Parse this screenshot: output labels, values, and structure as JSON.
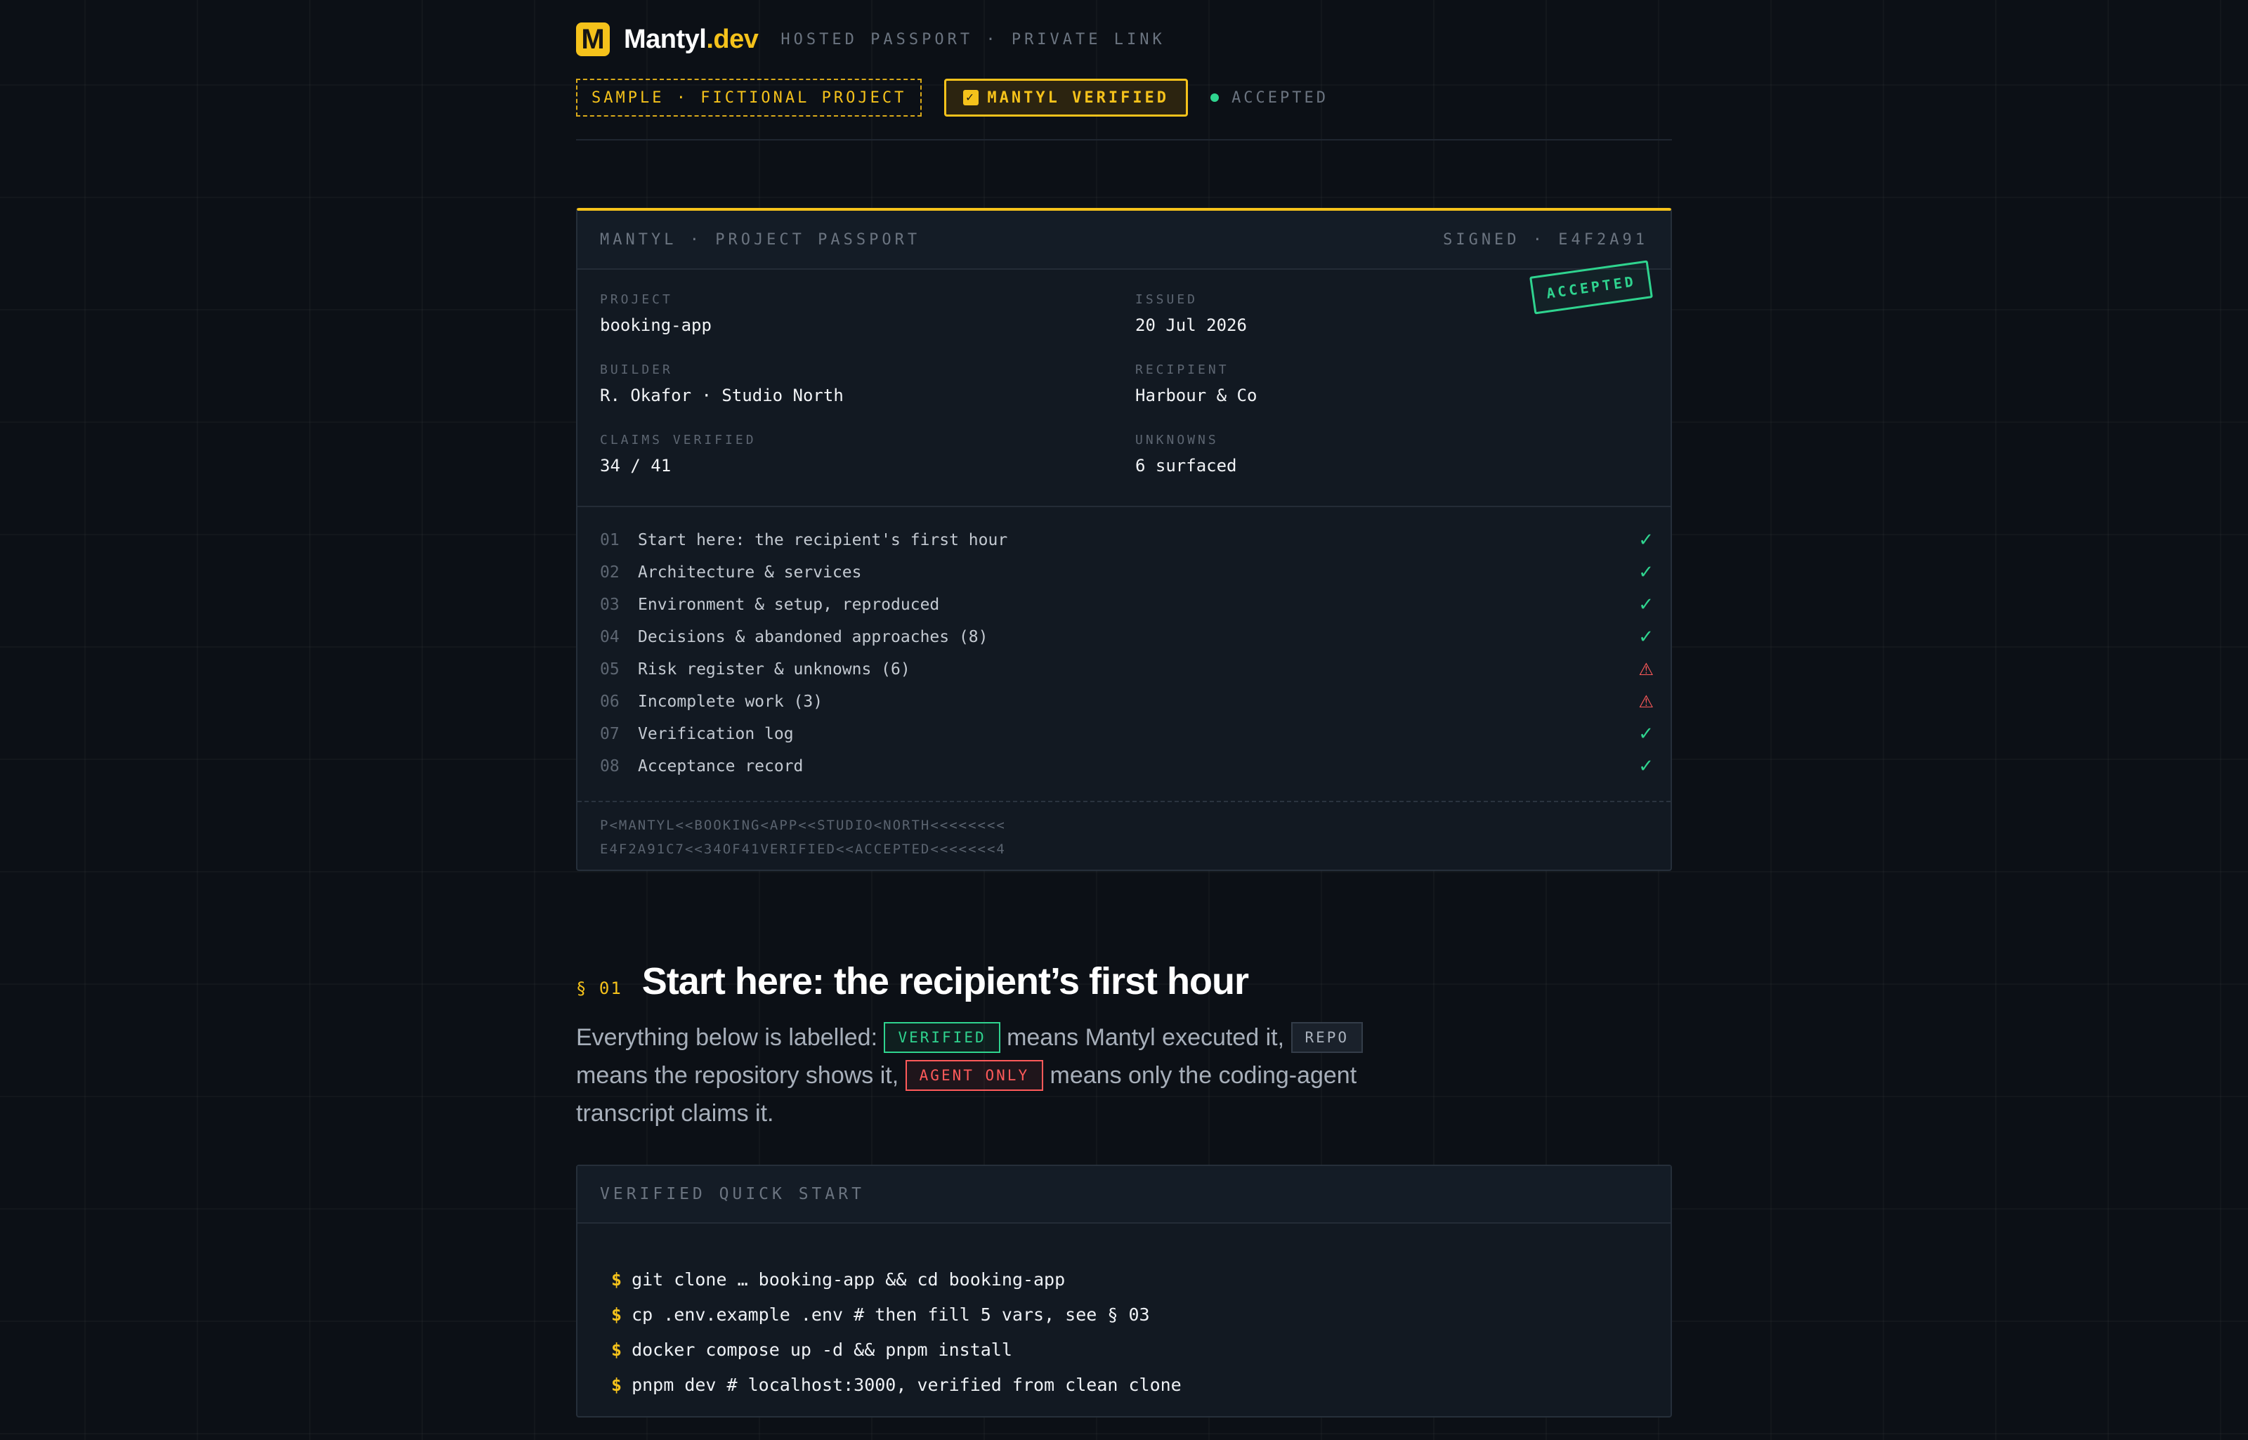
{
  "header": {
    "logo_letter": "M",
    "brand_name": "Mantyl",
    "brand_tld": ".dev",
    "tagline": "HOSTED PASSPORT · PRIVATE LINK"
  },
  "badges": {
    "sample": "SAMPLE · FICTIONAL PROJECT",
    "verified": "MANTYL VERIFIED",
    "status": "ACCEPTED"
  },
  "passport": {
    "title": "MANTYL · PROJECT PASSPORT",
    "signature": "SIGNED · E4F2A91",
    "stamp": "ACCEPTED",
    "fields": {
      "project_label": "PROJECT",
      "project_value": "booking-app",
      "issued_label": "ISSUED",
      "issued_value": "20 Jul 2026",
      "builder_label": "BUILDER",
      "builder_value": "R. Okafor · Studio North",
      "recipient_label": "RECIPIENT",
      "recipient_value": "Harbour & Co",
      "claims_label": "CLAIMS VERIFIED",
      "claims_value": "34 / 41",
      "unknowns_label": "UNKNOWNS",
      "unknowns_value": "6 surfaced"
    },
    "toc": [
      {
        "num": "01",
        "title": "Start here: the recipient's first hour",
        "status": "check-icon"
      },
      {
        "num": "02",
        "title": "Architecture & services",
        "status": "check-icon"
      },
      {
        "num": "03",
        "title": "Environment & setup, reproduced",
        "status": "check-icon"
      },
      {
        "num": "04",
        "title": "Decisions & abandoned approaches (8)",
        "status": "check-icon"
      },
      {
        "num": "05",
        "title": "Risk register & unknowns (6)",
        "status": "warning-icon"
      },
      {
        "num": "06",
        "title": "Incomplete work (3)",
        "status": "warning-icon"
      },
      {
        "num": "07",
        "title": "Verification log",
        "status": "check-icon"
      },
      {
        "num": "08",
        "title": "Acceptance record",
        "status": "check-icon"
      }
    ],
    "mrz_line1": "P<MANTYL<<BOOKING<APP<<STUDIO<NORTH<<<<<<<<",
    "mrz_line2": "E4F2A91C7<<34OF41VERIFIED<<ACCEPTED<<<<<<<4"
  },
  "section": {
    "number": "§ 01",
    "title": "Start here: the recipient’s first hour",
    "intro_1": "Everything below is labelled: ",
    "tag_verified": "VERIFIED",
    "intro_2": " means Mantyl executed it, ",
    "tag_repo": "REPO",
    "intro_3": " means the repository shows it, ",
    "tag_agent": "AGENT ONLY",
    "intro_4": " means only the coding-agent transcript claims it."
  },
  "quick_start": {
    "title": "VERIFIED QUICK START",
    "prompt": "$",
    "commands": [
      "git clone … booking-app && cd booking-app",
      "cp .env.example .env # then fill 5 vars, see § 03",
      "docker compose up -d && pnpm install",
      "pnpm dev # localhost:3000, verified from clean clone"
    ]
  },
  "colors": {
    "background": "#0c1016",
    "accent": "#f5c21b",
    "success": "#2fd48f",
    "danger": "#ff5a5a"
  }
}
